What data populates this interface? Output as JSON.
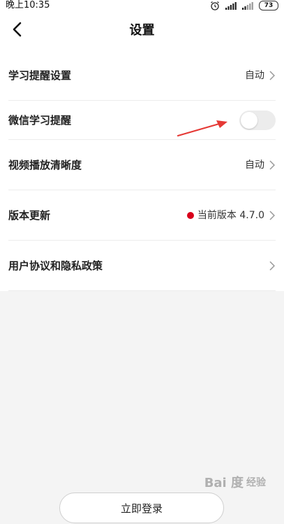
{
  "status_bar": {
    "time": "晚上10:35",
    "battery": "73",
    "icons": [
      "alarm-icon",
      "signal-icon",
      "signal-icon",
      "battery-icon"
    ]
  },
  "header": {
    "title": "设置",
    "back_icon": "back-arrow-icon"
  },
  "settings": {
    "study_reminder": {
      "label": "学习提醒设置",
      "value": "自动"
    },
    "wechat_reminder": {
      "label": "微信学习提醒",
      "enabled": false
    },
    "video_quality": {
      "label": "视频播放清晰度",
      "value": "自动"
    },
    "version_update": {
      "label": "版本更新",
      "value": "当前版本 4.7.0"
    },
    "agreement": {
      "label": "用户协议和隐私政策"
    }
  },
  "bottom": {
    "login_label": "立即登录"
  },
  "watermark": {
    "logo": "Bai 度",
    "text": "经验"
  },
  "colors": {
    "accent_red": "#d8001b",
    "toggle_off": "#ececec",
    "annotation_arrow": "#e53935"
  }
}
